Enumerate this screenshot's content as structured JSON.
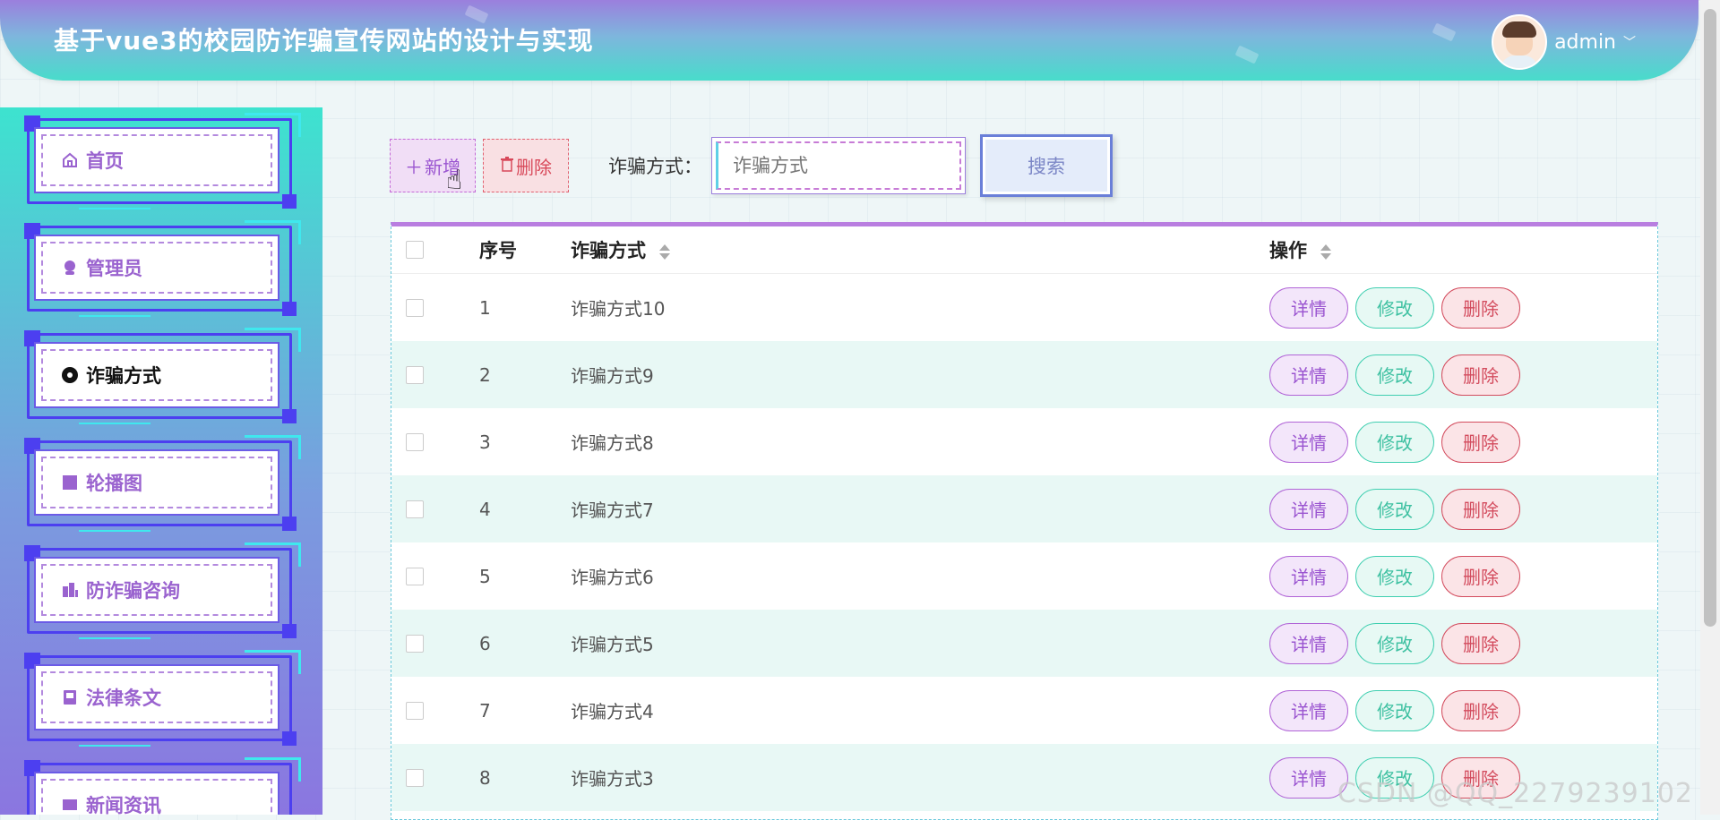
{
  "header": {
    "title": "基于vue3的校园防诈骗宣传网站的设计与实现",
    "username": "admin"
  },
  "sidebar": {
    "items": [
      {
        "label": "首页",
        "icon": "home-icon"
      },
      {
        "label": "管理员",
        "icon": "user-icon"
      },
      {
        "label": "诈骗方式",
        "icon": "circle-icon",
        "active": true
      },
      {
        "label": "轮播图",
        "icon": "square-icon"
      },
      {
        "label": "防诈骗咨询",
        "icon": "building-icon"
      },
      {
        "label": "法律条文",
        "icon": "book-icon"
      },
      {
        "label": "新闻资讯",
        "icon": "news-icon"
      }
    ]
  },
  "toolbar": {
    "add_label": "新增",
    "delete_label": "删除",
    "search_label": "诈骗方式：",
    "search_placeholder": "诈骗方式",
    "search_button": "搜索"
  },
  "table": {
    "headers": {
      "no": "序号",
      "name": "诈骗方式",
      "op": "操作"
    },
    "rows": [
      {
        "no": "1",
        "name": "诈骗方式10"
      },
      {
        "no": "2",
        "name": "诈骗方式9"
      },
      {
        "no": "3",
        "name": "诈骗方式8"
      },
      {
        "no": "4",
        "name": "诈骗方式7"
      },
      {
        "no": "5",
        "name": "诈骗方式6"
      },
      {
        "no": "6",
        "name": "诈骗方式5"
      },
      {
        "no": "7",
        "name": "诈骗方式4"
      },
      {
        "no": "8",
        "name": "诈骗方式3"
      }
    ],
    "actions": {
      "detail": "详情",
      "edit": "修改",
      "remove": "删除"
    }
  },
  "watermark": "CSDN @QQ_2279239102",
  "colors": {
    "accent": "#9b7fdd",
    "teal": "#48dccb",
    "danger": "#d34c5e"
  }
}
